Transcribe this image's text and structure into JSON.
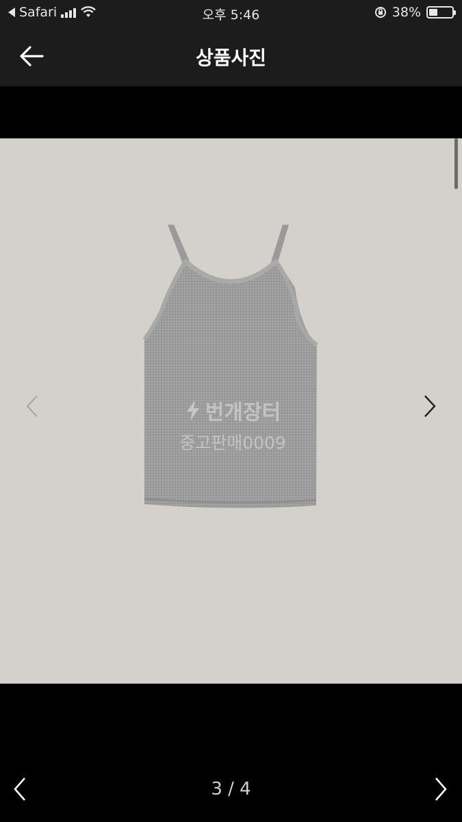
{
  "status_bar": {
    "back_app": "Safari",
    "time": "오후 5:46",
    "battery_percent": "38%",
    "battery_level": 0.38
  },
  "header": {
    "title": "상품사진"
  },
  "photo": {
    "watermark_brand": "번개장터",
    "watermark_sub": "중고판매0009"
  },
  "pager": {
    "indicator": "3 / 4"
  },
  "colors": {
    "header_bg": "#1c1c1c",
    "photo_bg": "#d4d1cd",
    "garment": "#9c9c9c"
  }
}
